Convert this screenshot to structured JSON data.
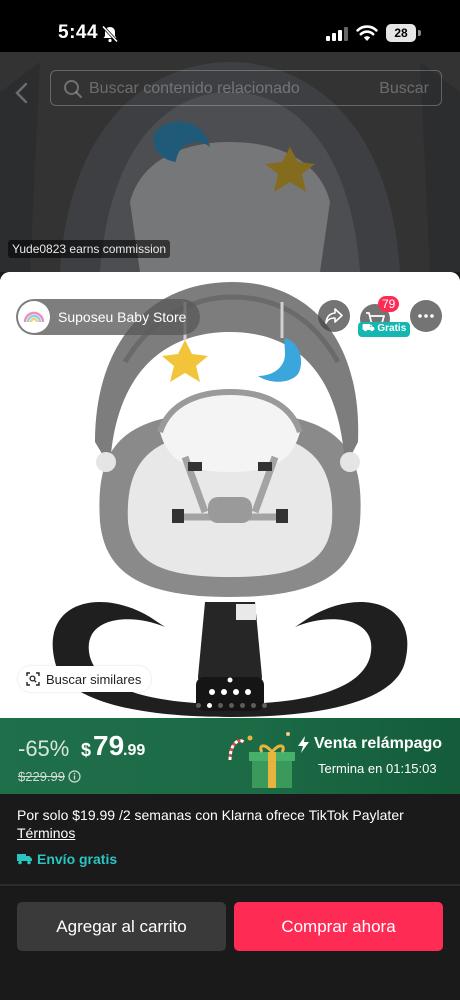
{
  "status_bar": {
    "time": "5:44",
    "battery": "28",
    "icons": [
      "bell-muted-icon",
      "signal-icon",
      "wifi-icon",
      "battery-icon"
    ]
  },
  "background_page": {
    "search_placeholder": "Buscar contenido relacionado",
    "search_button": "Buscar",
    "commission_tag": "Yude0823 earns commission"
  },
  "product_card": {
    "store_name": "Suposeu Baby Store",
    "cart_count": "79",
    "cart_badge": "Gratis",
    "similar_button": "Buscar similares",
    "image_count": 7,
    "active_image": 1
  },
  "flash_sale": {
    "discount": "-65%",
    "currency": "$",
    "price_main": "79",
    "price_cents": ".99",
    "old_price": "$229.99",
    "title": "Venta relámpago",
    "ends_label": "Termina en",
    "ends_time": "01:15:03"
  },
  "details": {
    "klarna_text": "Por solo $19.99 /2 semanas con  Klarna ofrece TikTok Paylater",
    "terms_link": "Términos",
    "shipping": "Envío gratis"
  },
  "actions": {
    "add_to_cart": "Agregar al carrito",
    "buy_now": "Comprar ahora"
  },
  "colors": {
    "accent": "#fe2c55",
    "banner_green": "#1f6f4a",
    "teal": "#29c6c0"
  }
}
